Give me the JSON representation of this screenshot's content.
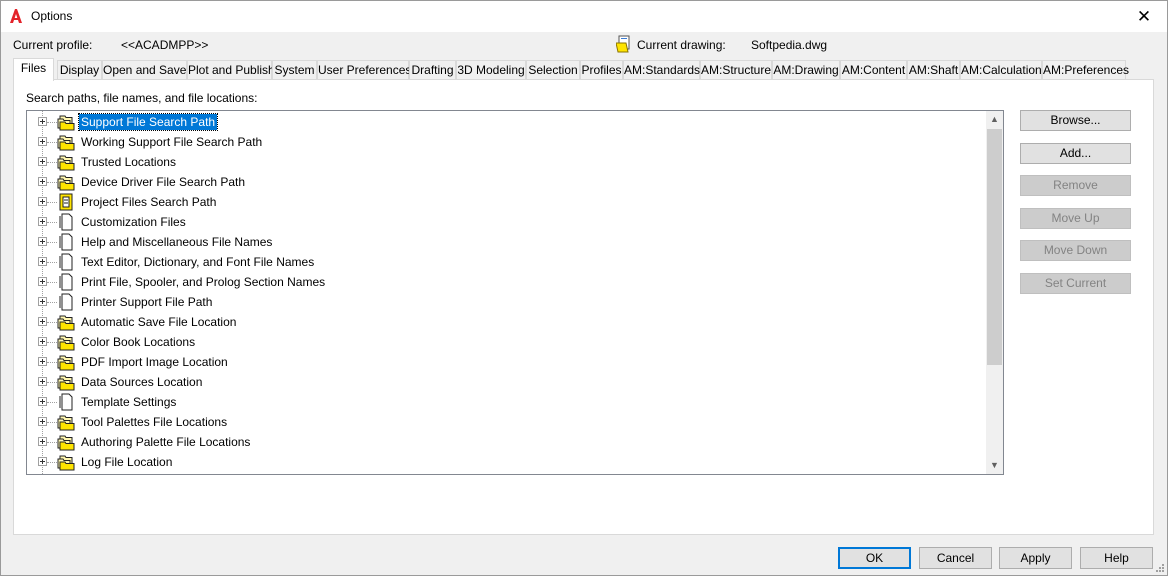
{
  "window": {
    "title": "Options",
    "close_label": "✕"
  },
  "profile": {
    "label": "Current profile:",
    "value": "<<ACADMPP>>"
  },
  "drawing": {
    "label": "Current drawing:",
    "value": "Softpedia.dwg"
  },
  "tabs": [
    {
      "label": "Files",
      "active": true
    },
    {
      "label": "Display"
    },
    {
      "label": "Open and Save"
    },
    {
      "label": "Plot and Publish"
    },
    {
      "label": "System"
    },
    {
      "label": "User Preferences"
    },
    {
      "label": "Drafting"
    },
    {
      "label": "3D Modeling"
    },
    {
      "label": "Selection"
    },
    {
      "label": "Profiles"
    },
    {
      "label": "AM:Standards"
    },
    {
      "label": "AM:Structure"
    },
    {
      "label": "AM:Drawing"
    },
    {
      "label": "AM:Content"
    },
    {
      "label": "AM:Shaft"
    },
    {
      "label": "AM:Calculation"
    },
    {
      "label": "AM:Preferences"
    }
  ],
  "files": {
    "section_label": "Search paths, file names, and file locations:",
    "tree": [
      {
        "label": "Support File Search Path",
        "icon": "folder-stack-icon",
        "selected": true
      },
      {
        "label": "Working Support File Search Path",
        "icon": "folder-stack-icon"
      },
      {
        "label": "Trusted Locations",
        "icon": "folder-stack-icon"
      },
      {
        "label": "Device Driver File Search Path",
        "icon": "folder-stack-icon"
      },
      {
        "label": "Project Files Search Path",
        "icon": "project-file-icon"
      },
      {
        "label": "Customization Files",
        "icon": "document-icon"
      },
      {
        "label": "Help and Miscellaneous File Names",
        "icon": "document-icon"
      },
      {
        "label": "Text Editor, Dictionary, and Font File Names",
        "icon": "document-icon"
      },
      {
        "label": "Print File, Spooler, and Prolog Section Names",
        "icon": "document-icon"
      },
      {
        "label": "Printer Support File Path",
        "icon": "document-icon"
      },
      {
        "label": "Automatic Save File Location",
        "icon": "folder-stack-icon"
      },
      {
        "label": "Color Book Locations",
        "icon": "folder-stack-icon"
      },
      {
        "label": "PDF Import Image Location",
        "icon": "folder-stack-icon"
      },
      {
        "label": "Data Sources Location",
        "icon": "folder-stack-icon"
      },
      {
        "label": "Template Settings",
        "icon": "document-icon"
      },
      {
        "label": "Tool Palettes File Locations",
        "icon": "folder-stack-icon"
      },
      {
        "label": "Authoring Palette File Locations",
        "icon": "folder-stack-icon"
      },
      {
        "label": "Log File Location",
        "icon": "folder-stack-icon"
      }
    ]
  },
  "side_buttons": [
    {
      "label": "Browse...",
      "enabled": true
    },
    {
      "label": "Add...",
      "enabled": true
    },
    {
      "label": "Remove",
      "enabled": false
    },
    {
      "label": "Move Up",
      "enabled": false
    },
    {
      "label": "Move Down",
      "enabled": false
    },
    {
      "label": "Set Current",
      "enabled": false
    }
  ],
  "buttons": {
    "ok": "OK",
    "cancel": "Cancel",
    "apply": "Apply",
    "help": "Help"
  },
  "colors": {
    "selection": "#0078d7",
    "folder_yellow": "#ffe400",
    "app_red": "#e3232a"
  }
}
